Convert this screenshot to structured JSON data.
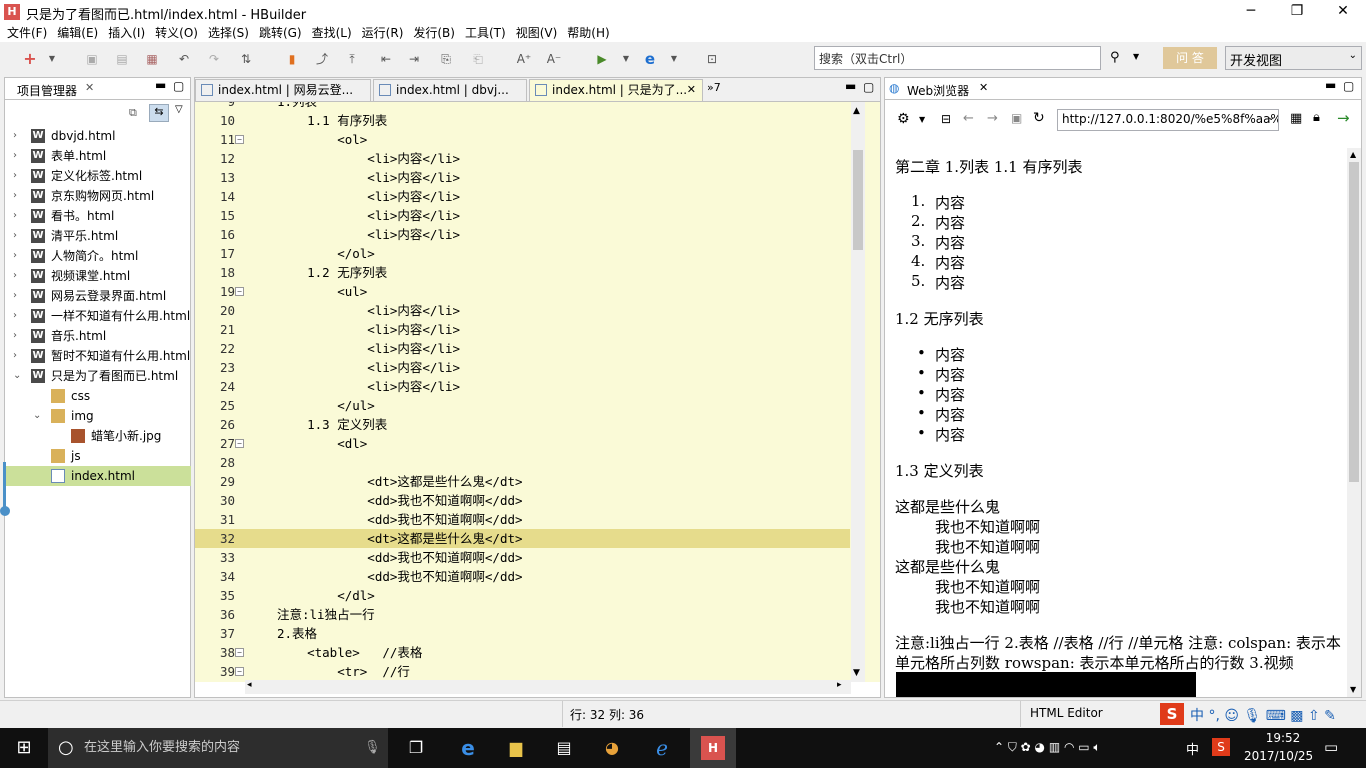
{
  "window": {
    "title": "只是为了看图而已.html/index.html  -  HBuilder",
    "app_icon": "H"
  },
  "menu": [
    "文件(F)",
    "编辑(E)",
    "插入(I)",
    "转义(O)",
    "选择(S)",
    "跳转(G)",
    "查找(L)",
    "运行(R)",
    "发行(B)",
    "工具(T)",
    "视图(V)",
    "帮助(H)"
  ],
  "toolbar": {
    "search_placeholder": "搜索（双击Ctrl）",
    "ask_label": "问 答",
    "view_select": "开发视图"
  },
  "project": {
    "tab_label": "项目管理器",
    "items": [
      {
        "label": "dbvjd.html",
        "type": "w",
        "indent": 0,
        "twisty": "›"
      },
      {
        "label": "表单.html",
        "type": "w",
        "indent": 0,
        "twisty": "›"
      },
      {
        "label": "定义化标签.html",
        "type": "w",
        "indent": 0,
        "twisty": "›"
      },
      {
        "label": "京东购物网页.html",
        "type": "w",
        "indent": 0,
        "twisty": "›"
      },
      {
        "label": "看书。html",
        "type": "w",
        "indent": 0,
        "twisty": "›"
      },
      {
        "label": "清平乐.html",
        "type": "w",
        "indent": 0,
        "twisty": "›"
      },
      {
        "label": "人物简介。html",
        "type": "w",
        "indent": 0,
        "twisty": "›"
      },
      {
        "label": "视频课堂.html",
        "type": "w",
        "indent": 0,
        "twisty": "›"
      },
      {
        "label": "网易云登录界面.html",
        "type": "w",
        "indent": 0,
        "twisty": "›"
      },
      {
        "label": "一样不知道有什么用.html",
        "type": "w",
        "indent": 0,
        "twisty": "›"
      },
      {
        "label": "音乐.html",
        "type": "w",
        "indent": 0,
        "twisty": "›"
      },
      {
        "label": "暂时不知道有什么用.html",
        "type": "w",
        "indent": 0,
        "twisty": "›"
      },
      {
        "label": "只是为了看图而已.html",
        "type": "w",
        "indent": 0,
        "twisty": "⌄"
      },
      {
        "label": "css",
        "type": "f",
        "indent": 1,
        "twisty": ""
      },
      {
        "label": "img",
        "type": "f",
        "indent": 1,
        "twisty": "⌄"
      },
      {
        "label": "蜡笔小新.jpg",
        "type": "i",
        "indent": 2,
        "twisty": ""
      },
      {
        "label": "js",
        "type": "f",
        "indent": 1,
        "twisty": ""
      },
      {
        "label": "index.html",
        "type": "h",
        "indent": 1,
        "twisty": "",
        "selected": true
      }
    ]
  },
  "editor": {
    "tabs": [
      "index.html | 网易云登...",
      "index.html | dbvj...",
      "index.html | 只是为了...",
      "»7"
    ],
    "lines": [
      {
        "n": "10",
        "text": "    1.1 有序列表",
        "fold": false
      },
      {
        "n": "11",
        "text": "        <ol>",
        "fold": true
      },
      {
        "n": "12",
        "text": "            <li>内容</li>",
        "fold": false
      },
      {
        "n": "13",
        "text": "            <li>内容</li>",
        "fold": false
      },
      {
        "n": "14",
        "text": "            <li>内容</li>",
        "fold": false
      },
      {
        "n": "15",
        "text": "            <li>内容</li>",
        "fold": false
      },
      {
        "n": "16",
        "text": "            <li>内容</li>",
        "fold": false
      },
      {
        "n": "17",
        "text": "        </ol>",
        "fold": false
      },
      {
        "n": "18",
        "text": "    1.2 无序列表",
        "fold": false
      },
      {
        "n": "19",
        "text": "        <ul>",
        "fold": true
      },
      {
        "n": "20",
        "text": "            <li>内容</li>",
        "fold": false
      },
      {
        "n": "21",
        "text": "            <li>内容</li>",
        "fold": false
      },
      {
        "n": "22",
        "text": "            <li>内容</li>",
        "fold": false
      },
      {
        "n": "23",
        "text": "            <li>内容</li>",
        "fold": false
      },
      {
        "n": "24",
        "text": "            <li>内容</li>",
        "fold": false
      },
      {
        "n": "25",
        "text": "        </ul>",
        "fold": false
      },
      {
        "n": "26",
        "text": "    1.3 定义列表",
        "fold": false
      },
      {
        "n": "27",
        "text": "        <dl>",
        "fold": true
      },
      {
        "n": "28",
        "text": "",
        "fold": false
      },
      {
        "n": "29",
        "text": "            <dt>这都是些什么鬼</dt>",
        "fold": false
      },
      {
        "n": "30",
        "text": "            <dd>我也不知道啊啊</dd>",
        "fold": false
      },
      {
        "n": "31",
        "text": "            <dd>我也不知道啊啊</dd>",
        "fold": false
      },
      {
        "n": "32",
        "text": "            <dt>这都是些什么鬼</dt>",
        "fold": false,
        "highlight": true
      },
      {
        "n": "33",
        "text": "            <dd>我也不知道啊啊</dd>",
        "fold": false
      },
      {
        "n": "34",
        "text": "            <dd>我也不知道啊啊</dd>",
        "fold": false
      },
      {
        "n": "35",
        "text": "        </dl>",
        "fold": false
      },
      {
        "n": "36",
        "text": "注意:li独占一行",
        "fold": false
      },
      {
        "n": "37",
        "text": "2.表格",
        "fold": false
      },
      {
        "n": "38",
        "text": "    <table>   //表格",
        "fold": true
      },
      {
        "n": "39",
        "text": "        <tr>  //行",
        "fold": true
      }
    ]
  },
  "browser": {
    "tab_label": "Web浏览器",
    "url": "http://127.0.0.1:8020/%e5%8f%aa%",
    "heading": "第二章 1.列表 1.1 有序列表",
    "ol_items": [
      "内容",
      "内容",
      "内容",
      "内容",
      "内容"
    ],
    "ol_markers": [
      "1.",
      "2.",
      "3.",
      "4.",
      "5."
    ],
    "ul_heading": "1.2 无序列表",
    "ul_items": [
      "内容",
      "内容",
      "内容",
      "内容",
      "内容"
    ],
    "dl_heading": "1.3 定义列表",
    "dl": [
      {
        "t": "这都是些什么鬼",
        "d": [
          "我也不知道啊啊",
          "我也不知道啊啊"
        ]
      },
      {
        "t": "这都是些什么鬼",
        "d": [
          "我也不知道啊啊",
          "我也不知道啊啊"
        ]
      }
    ],
    "note_line1": "注意:li独占一行 2.表格 //表格 //行 //单元格 注意: colspan: 表示本",
    "note_line2": "单元格所占列数 rowspan: 表示本单元格所占的行数 3.视频"
  },
  "status": {
    "position": "行: 32 列: 36",
    "editor_type": "HTML Editor"
  },
  "taskbar": {
    "search_placeholder": "在这里输入你要搜索的内容",
    "time": "19:52",
    "date": "2017/10/25",
    "ime": "中"
  }
}
